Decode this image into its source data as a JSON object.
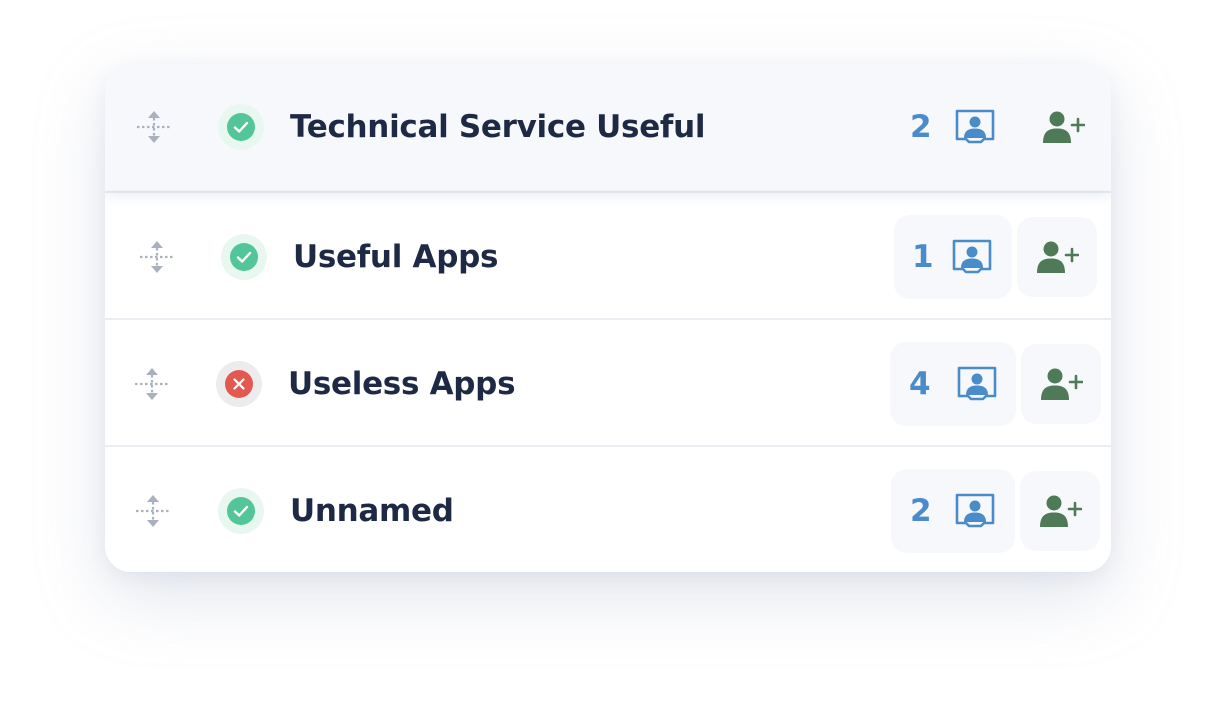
{
  "rows": [
    {
      "name": "Technical Service Useful",
      "count": "2",
      "status": "ok",
      "status_icon": "check-icon"
    },
    {
      "name": "Useful Apps",
      "count": "1",
      "status": "ok",
      "status_icon": "check-icon"
    },
    {
      "name": "Useless Apps",
      "count": "4",
      "status": "bad",
      "status_icon": "x-icon"
    },
    {
      "name": "Unnamed",
      "count": "2",
      "status": "ok",
      "status_icon": "check-icon"
    }
  ],
  "icons": {
    "drag": "drag-move-icon",
    "folder": "contact-folder-icon",
    "add_user": "add-user-icon"
  },
  "colors": {
    "ok": "#52c69a",
    "bad": "#e25a4f",
    "count": "#4a8cca",
    "add_user": "#4f7a57",
    "text": "#1e2a45"
  }
}
